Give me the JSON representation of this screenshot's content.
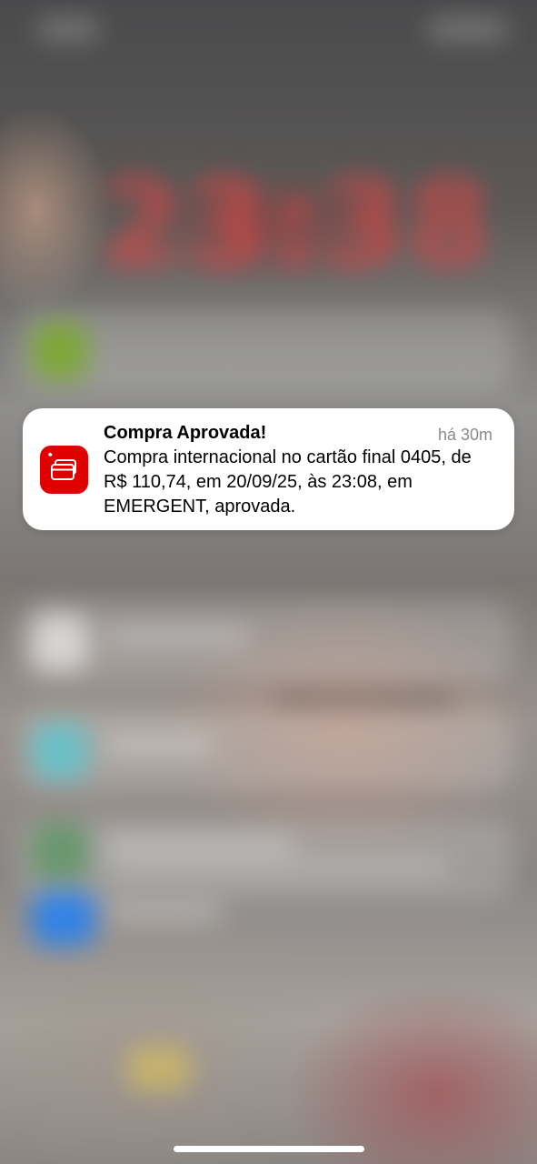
{
  "lockscreen": {
    "clock_text": "23:38"
  },
  "notification": {
    "app_icon": "santander-card-icon",
    "title": "Compra Aprovada!",
    "time": "há 30m",
    "body": "Compra internacional no cartão final 0405, de R$ 110,74, em 20/09/25, às 23:08, em EMERGENT, aprovada.",
    "icon_color": "#e00000"
  },
  "home_indicator": {
    "color": "#ffffff"
  }
}
